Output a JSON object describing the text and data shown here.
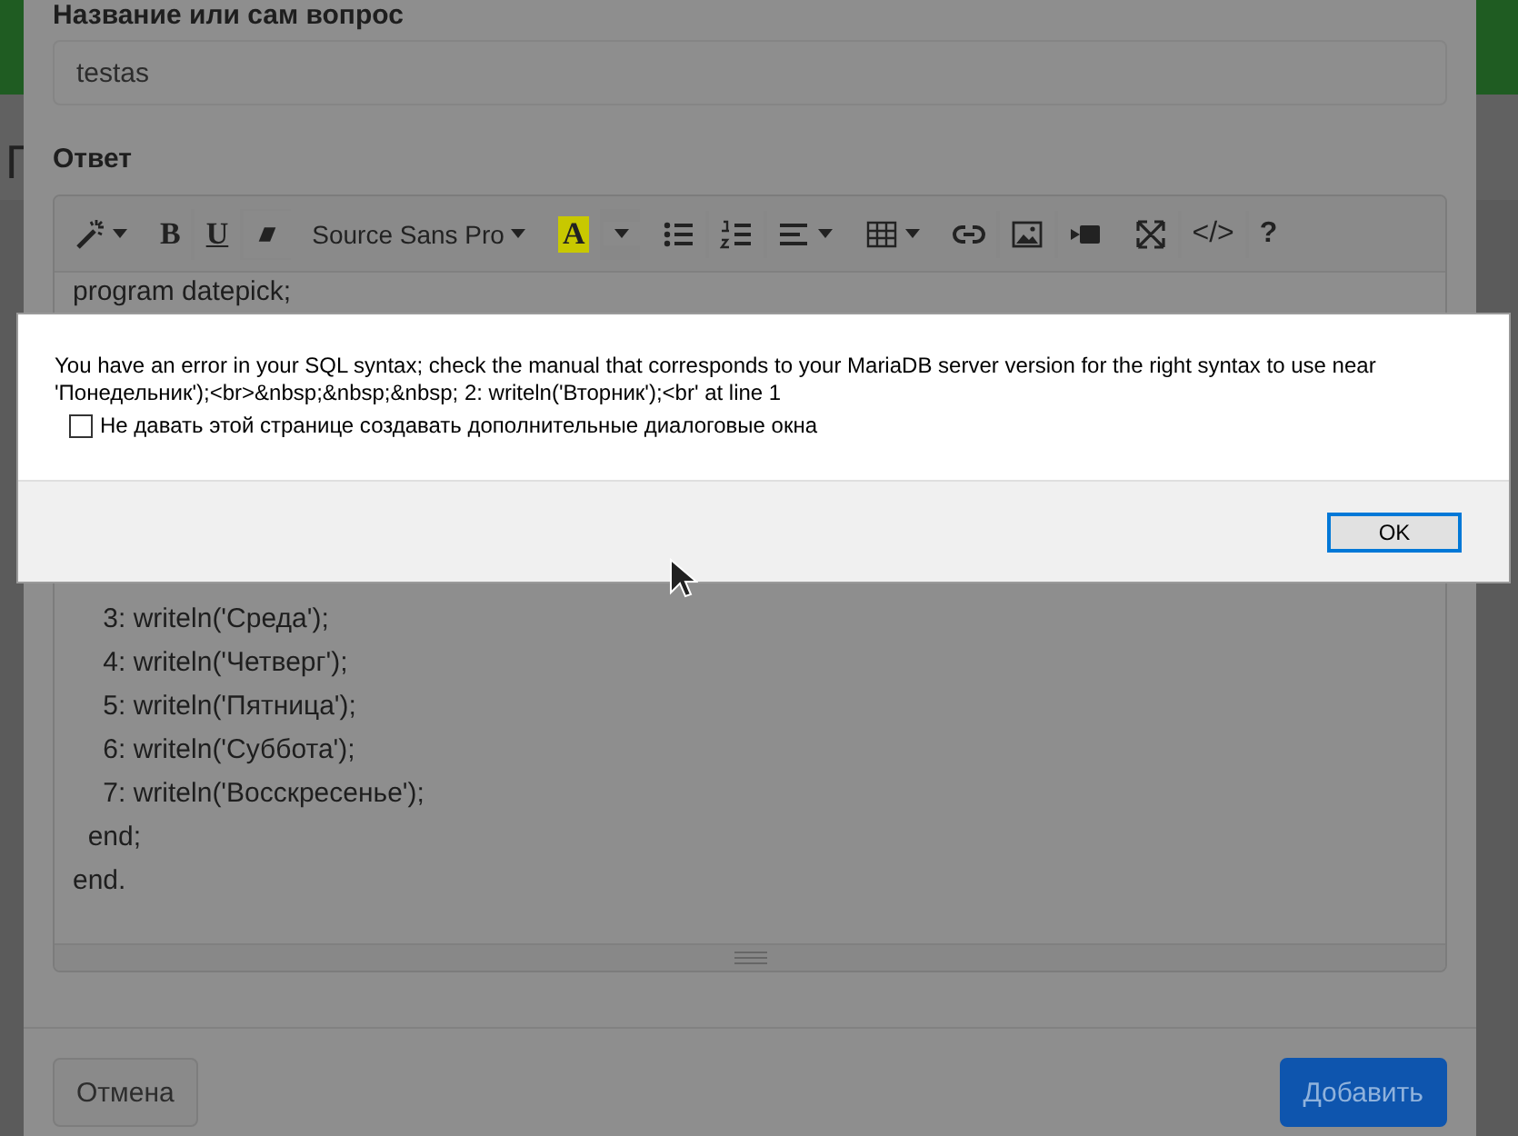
{
  "background_page": {
    "heading_fragment": "Г"
  },
  "modal": {
    "title_label": "Название или сам вопрос",
    "title_value": "testas",
    "answer_label": "Ответ",
    "toolbar": [
      {
        "items": [
          {
            "kind": "wand",
            "caret": true
          }
        ]
      },
      {
        "items": [
          {
            "kind": "bold",
            "label": "B",
            "caret": false
          },
          {
            "kind": "underline",
            "label": "U",
            "caret": false
          },
          {
            "kind": "eraser",
            "caret": false
          }
        ]
      },
      {
        "items": [
          {
            "kind": "font",
            "label": "Source Sans Pro",
            "caret": true
          }
        ]
      },
      {
        "items": [
          {
            "kind": "highlight",
            "label": "A",
            "caret": false
          },
          {
            "kind": "caret",
            "caret": true
          }
        ]
      },
      {
        "items": [
          {
            "kind": "bullets",
            "caret": false
          },
          {
            "kind": "numbers",
            "caret": false
          },
          {
            "kind": "align",
            "caret": true
          }
        ]
      },
      {
        "items": [
          {
            "kind": "table",
            "caret": true
          }
        ]
      },
      {
        "items": [
          {
            "kind": "link",
            "caret": false
          },
          {
            "kind": "picture",
            "caret": false
          },
          {
            "kind": "video",
            "caret": false
          }
        ]
      },
      {
        "items": [
          {
            "kind": "fullscreen",
            "caret": false
          },
          {
            "kind": "code",
            "label": "</>",
            "caret": false
          },
          {
            "kind": "help",
            "label": "?",
            "caret": false
          }
        ]
      }
    ],
    "code_top": [
      "program datepick;"
    ],
    "code_bottom": [
      "    3: writeln('Среда');",
      "    4: writeln('Четверг');",
      "    5: writeln('Пятница');",
      "    6: writeln('Суббота');",
      "    7: writeln('Восскресенье');",
      "  end;",
      "end."
    ],
    "buttons": [
      {
        "label": "Отмена",
        "kind": "secondary"
      },
      {
        "label": "Добавить",
        "kind": "primary"
      }
    ]
  },
  "alert": {
    "message": "You have an error in your SQL syntax; check the manual that corresponds to your MariaDB server version for the right syntax to use near 'Понедельник');<br>&nbsp;&nbsp;&nbsp; 2: writeln('Вторник');<br' at line 1",
    "suppress": {
      "label": "Не давать этой странице создавать дополнительные диалоговые окна",
      "checked": false
    },
    "ok_label": "OK"
  }
}
